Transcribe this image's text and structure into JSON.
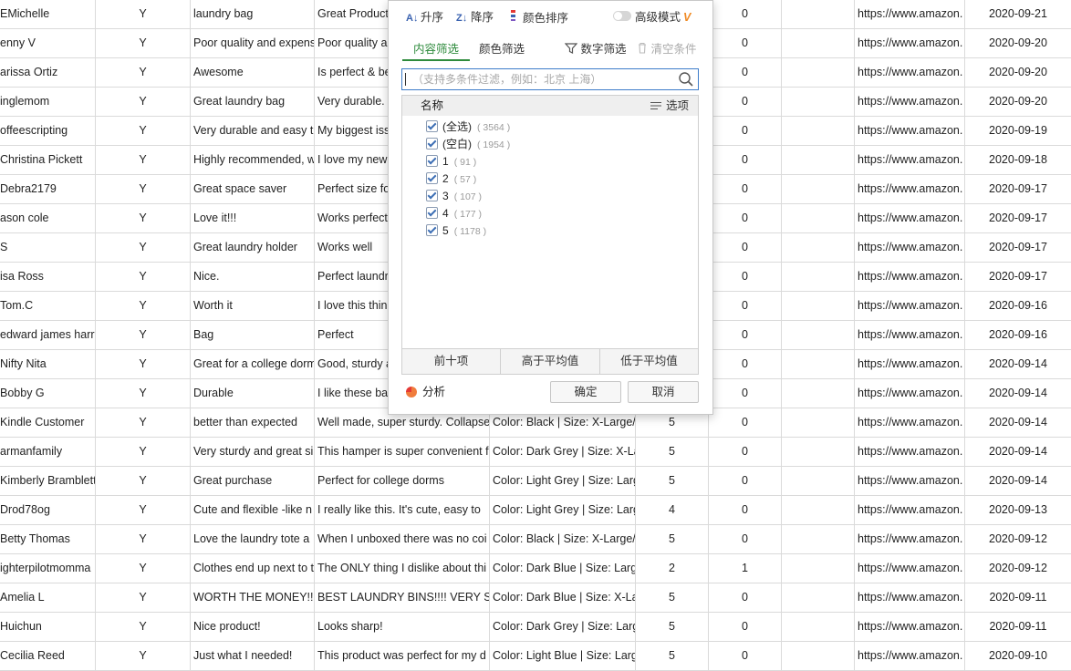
{
  "grid": {
    "rows": [
      [
        "EMichelle",
        "Y",
        "laundry bag",
        "Great Product",
        "",
        "",
        "0",
        "",
        "https://www.amazon.",
        "2020-09-21"
      ],
      [
        "enny V",
        "Y",
        "Poor quality and expens",
        "Poor quality a",
        "",
        "",
        "0",
        "",
        "https://www.amazon.",
        "2020-09-20"
      ],
      [
        "arissa Ortiz",
        "Y",
        "Awesome",
        "Is perfect & be",
        "",
        "",
        "0",
        "",
        "https://www.amazon.",
        "2020-09-20"
      ],
      [
        "inglemom",
        "Y",
        "Great laundry bag",
        "Very durable.",
        "",
        "",
        "0",
        "",
        "https://www.amazon.",
        "2020-09-20"
      ],
      [
        "offeescripting",
        "Y",
        "Very durable and easy t",
        "My biggest iss",
        "",
        "",
        "0",
        "",
        "https://www.amazon.",
        "2020-09-19"
      ],
      [
        "Christina Pickett",
        "Y",
        "Highly recommended, w",
        "I love my new",
        "",
        "",
        "0",
        "",
        "https://www.amazon.",
        "2020-09-18"
      ],
      [
        "Debra2179",
        "Y",
        "Great space saver",
        "Perfect size fo",
        "",
        "",
        "0",
        "",
        "https://www.amazon.",
        "2020-09-17"
      ],
      [
        "ason cole",
        "Y",
        "Love it!!!",
        "Works perfect",
        "",
        "",
        "0",
        "",
        "https://www.amazon.",
        "2020-09-17"
      ],
      [
        "S",
        "Y",
        "Great laundry holder",
        "Works well",
        "",
        "",
        "0",
        "",
        "https://www.amazon.",
        "2020-09-17"
      ],
      [
        "isa Ross",
        "Y",
        "Nice.",
        "Perfect laundr",
        "",
        "",
        "0",
        "",
        "https://www.amazon.",
        "2020-09-17"
      ],
      [
        "Tom.C",
        "Y",
        "Worth it",
        "I love this thin",
        "",
        "",
        "0",
        "",
        "https://www.amazon.",
        "2020-09-16"
      ],
      [
        "edward james harris",
        "Y",
        "Bag",
        "Perfect",
        "",
        "",
        "0",
        "",
        "https://www.amazon.",
        "2020-09-16"
      ],
      [
        "Nifty Nita",
        "Y",
        "Great for a college dorm",
        "Good, sturdy a",
        "",
        "",
        "0",
        "",
        "https://www.amazon.",
        "2020-09-14"
      ],
      [
        "Bobby G",
        "Y",
        "Durable",
        "I like these ba",
        "",
        "",
        "0",
        "",
        "https://www.amazon.",
        "2020-09-14"
      ],
      [
        "Kindle Customer",
        "Y",
        "better than expected",
        "Well made, super sturdy. Collapse",
        "Color: Black | Size: X-Large/",
        "5",
        "0",
        "",
        "https://www.amazon.",
        "2020-09-14"
      ],
      [
        "armanfamily",
        "Y",
        "Very sturdy and great si",
        "This hamper is super convenient f",
        "Color: Dark Grey | Size: X-La",
        "5",
        "0",
        "",
        "https://www.amazon.",
        "2020-09-14"
      ],
      [
        "Kimberly Bramblett",
        "Y",
        "Great purchase",
        "Perfect for college dorms",
        "Color: Light Grey | Size: Larg",
        "5",
        "0",
        "",
        "https://www.amazon.",
        "2020-09-14"
      ],
      [
        "Drod78og",
        "Y",
        "Cute and flexible -like n",
        "I really like this.  It's cute, easy to",
        "Color: Light Grey | Size: Larg",
        "4",
        "0",
        "",
        "https://www.amazon.",
        "2020-09-13"
      ],
      [
        "Betty Thomas",
        "Y",
        "Love the  laundry tote a",
        "When I unboxed there was no coi",
        "Color: Black | Size: X-Large/",
        "5",
        "0",
        "",
        "https://www.amazon.",
        "2020-09-12"
      ],
      [
        "ighterpilotmomma",
        "Y",
        "Clothes end up next to t",
        "The ONLY thing I dislike about thi",
        "Color: Dark Blue | Size: Larg",
        "2",
        "1",
        "",
        "https://www.amazon.",
        "2020-09-12"
      ],
      [
        "Amelia L",
        "Y",
        "WORTH THE MONEY!!!",
        "BEST LAUNDRY BINS!!!! VERY SA",
        "Color: Dark Blue | Size: X-La",
        "5",
        "0",
        "",
        "https://www.amazon.",
        "2020-09-11"
      ],
      [
        "Huichun",
        "Y",
        "Nice product!",
        "Looks sharp!",
        "Color: Dark Grey | Size: Larg",
        "5",
        "0",
        "",
        "https://www.amazon.",
        "2020-09-11"
      ],
      [
        "Cecilia Reed",
        "Y",
        "Just what I needed!",
        "This product was perfect for my d",
        "Color: Light Blue | Size: Larg",
        "5",
        "0",
        "",
        "https://www.amazon.",
        "2020-09-10"
      ]
    ]
  },
  "filter": {
    "sort_asc": "升序",
    "sort_desc": "降序",
    "sort_color": "颜色排序",
    "advanced_mode": "高级模式",
    "tab_content": "内容筛选",
    "tab_color": "颜色筛选",
    "number_filter": "数字筛选",
    "clear_condition": "清空条件",
    "search_placeholder": "（支持多条件过滤，例如：北京  上海）",
    "list_header": "名称",
    "options_label": "选项",
    "items": [
      {
        "label": "(全选)",
        "count": "( 3564 )"
      },
      {
        "label": "(空白)",
        "count": "( 1954 )"
      },
      {
        "label": "1",
        "count": "( 91 )"
      },
      {
        "label": "2",
        "count": "( 57 )"
      },
      {
        "label": "3",
        "count": "( 107 )"
      },
      {
        "label": "4",
        "count": "( 177 )"
      },
      {
        "label": "5",
        "count": "( 1178 )"
      }
    ],
    "top_ten": "前十项",
    "above_avg": "高于平均值",
    "below_avg": "低于平均值",
    "analyze": "分析",
    "ok": "确定",
    "cancel": "取消",
    "colors": {
      "accent_green": "#2e8b3c",
      "focus_blue": "#3d7cc9",
      "vip_orange": "#f08a24"
    }
  }
}
